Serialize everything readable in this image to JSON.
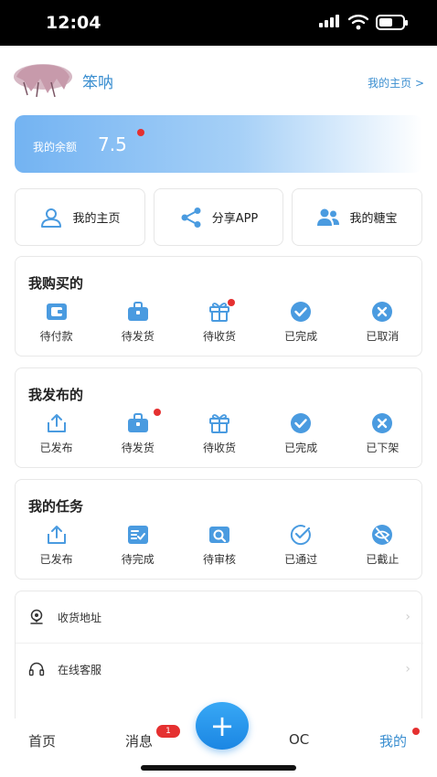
{
  "status_bar": {
    "time": "12:04"
  },
  "profile": {
    "username": "笨呐",
    "homepage_link": "我的主页 >"
  },
  "balance": {
    "label": "我的余额",
    "amount": "7.5"
  },
  "quick_actions": [
    {
      "label": "我的主页",
      "icon": "user-icon"
    },
    {
      "label": "分享APP",
      "icon": "share-icon"
    },
    {
      "label": "我的糖宝",
      "icon": "users-icon"
    }
  ],
  "purchased": {
    "title": "我购买的",
    "items": [
      {
        "label": "待付款",
        "icon": "wallet-icon"
      },
      {
        "label": "待发货",
        "icon": "bag-icon"
      },
      {
        "label": "待收货",
        "icon": "gift-icon",
        "has_dot": true
      },
      {
        "label": "已完成",
        "icon": "check-circle-icon"
      },
      {
        "label": "已取消",
        "icon": "x-circle-icon"
      }
    ]
  },
  "published": {
    "title": "我发布的",
    "items": [
      {
        "label": "已发布",
        "icon": "upload-icon"
      },
      {
        "label": "待发货",
        "icon": "bag-icon",
        "has_dot": true
      },
      {
        "label": "待收货",
        "icon": "gift-icon"
      },
      {
        "label": "已完成",
        "icon": "check-circle-icon"
      },
      {
        "label": "已下架",
        "icon": "x-circle-icon"
      }
    ]
  },
  "tasks": {
    "title": "我的任务",
    "items": [
      {
        "label": "已发布",
        "icon": "upload-icon"
      },
      {
        "label": "待完成",
        "icon": "checklist-icon"
      },
      {
        "label": "待审核",
        "icon": "review-icon"
      },
      {
        "label": "已通过",
        "icon": "check-outline-icon"
      },
      {
        "label": "已截止",
        "icon": "eye-off-icon"
      }
    ]
  },
  "menu": [
    {
      "label": "收货地址",
      "icon": "location-icon"
    },
    {
      "label": "在线客服",
      "icon": "headset-icon"
    }
  ],
  "tabbar": {
    "home": "首页",
    "messages": "消息",
    "messages_badge": "1",
    "oc": "OC",
    "mine": "我的",
    "fab": "+"
  },
  "colors": {
    "accent": "#3a8ed0",
    "badge": "#e53030",
    "icon": "#4a9be0"
  }
}
